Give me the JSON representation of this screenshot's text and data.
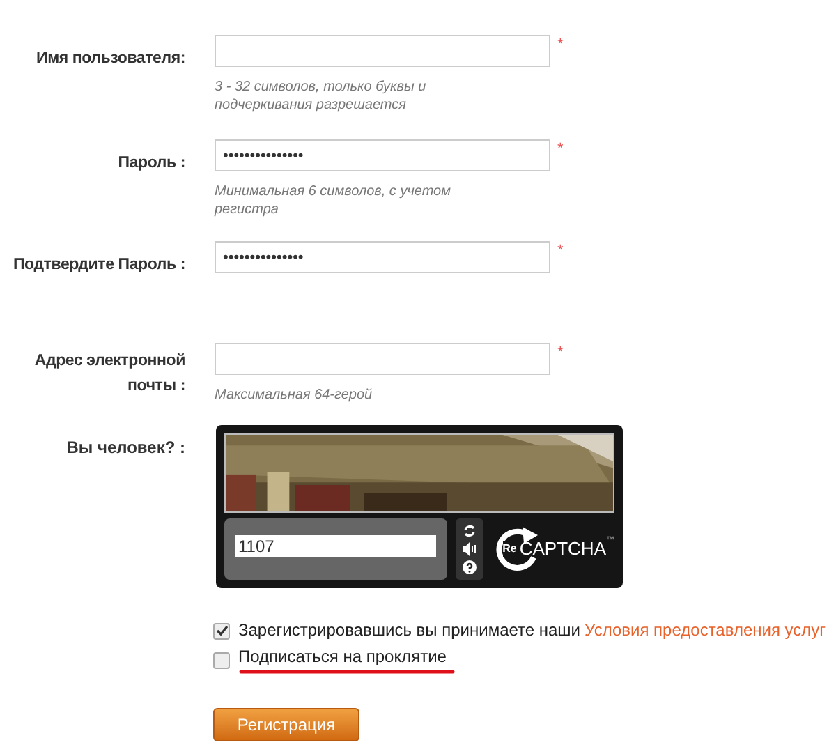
{
  "fields": [
    {
      "label": "Имя пользователя:",
      "required_mark": "*",
      "hint": "3 - 32 символов, только буквы и подчеркивания разрешается"
    },
    {
      "label": "Пароль :",
      "value": "•••••••••••••••",
      "required_mark": "*",
      "hint": "Минимальная 6 символов, с учетом регистра"
    },
    {
      "label": "Подтвердите Пароль :",
      "value": "•••••••••••••••",
      "required_mark": "*"
    },
    {
      "label": "Адрес электронной почты :",
      "required_mark": "*",
      "hint": "Максимальная 64-герой"
    }
  ],
  "captcha": {
    "label": "Вы человек? :",
    "value": "1107",
    "logo_prefix": "Re",
    "logo_text": "CAPTCHA",
    "logo_tm": "™"
  },
  "checkboxes": [
    {
      "text": "Зарегистрировавшись вы принимаете наши",
      "link": "Условия предоставления услуг",
      "checked": true,
      "underlined": false
    },
    {
      "text": "Подписаться на проклятие",
      "checked": false,
      "underlined": true
    }
  ],
  "submit": "Регистрация"
}
